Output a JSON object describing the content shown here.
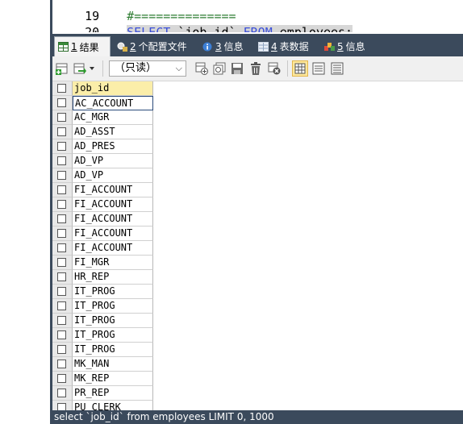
{
  "editor": {
    "prev_line_number": "19",
    "prev_line_text": "#==============",
    "cur_line_number": "20",
    "query": {
      "kw1": "SELECT",
      "mid": " `job_id` ",
      "kw2": "FROM",
      "rest": " employees;"
    }
  },
  "tabs": [
    {
      "num": "1",
      "label": "结果"
    },
    {
      "num": "2",
      "label": "个配置文件"
    },
    {
      "num": "3",
      "label": "信息"
    },
    {
      "num": "4",
      "label": "表数据"
    },
    {
      "num": "5",
      "label": "信息"
    }
  ],
  "toolbar": {
    "mode_select": "（只读）"
  },
  "grid": {
    "column_header": "job_id",
    "rows": [
      "AC_ACCOUNT",
      "AC_MGR",
      "AD_ASST",
      "AD_PRES",
      "AD_VP",
      "AD_VP",
      "FI_ACCOUNT",
      "FI_ACCOUNT",
      "FI_ACCOUNT",
      "FI_ACCOUNT",
      "FI_ACCOUNT",
      "FI_MGR",
      "HR_REP",
      "IT_PROG",
      "IT_PROG",
      "IT_PROG",
      "IT_PROG",
      "IT_PROG",
      "MK_MAN",
      "MK_REP",
      "PR_REP",
      "PU_CLERK"
    ]
  },
  "status": {
    "text": "select `job_id` from employees LIMIT 0, 1000"
  },
  "colors": {
    "dark_bar": "#3b4a5c",
    "keyword": "#3b4fd8",
    "header_cell": "#fbeea9"
  }
}
